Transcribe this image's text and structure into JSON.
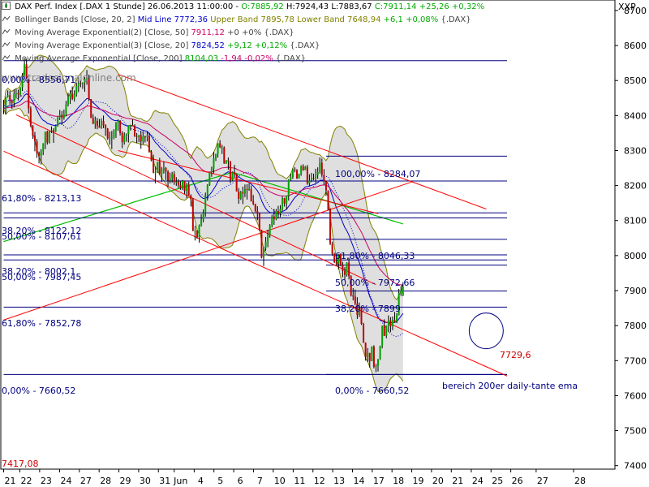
{
  "header": {
    "row1": {
      "symbol": "DAX Perf. Index [.DAX  1 Stunde]",
      "datetime": "26.06.2013 11:00:00",
      "open": "O:7885,92",
      "high": "H:7924,43",
      "low": "L:7883,67",
      "close": "C:7911,14",
      "change": "+25,26",
      "change_pct": "+0,32%"
    },
    "row2": {
      "name": "Bollinger Bands [Close, 20, 2]",
      "mid": "Mid Line 7772,36",
      "upper": "Upper Band 7895,78",
      "lower": "Lower Band 7648,94",
      "chg": "+6,1",
      "pct": "+0,08%",
      "sym": "{.DAX}"
    },
    "row3": {
      "name": "Moving Average Exponential(2) [Close, 50]",
      "value": "7911,12",
      "chg": "+0",
      "pct": "+0%",
      "sym": "{.DAX}"
    },
    "row4": {
      "name": "Moving Average Exponential(3) [Close, 20]",
      "value": "7824,52",
      "chg": "+9,12",
      "pct": "+0,12%",
      "sym": "{.DAX}"
    },
    "row5": {
      "name": "Moving Average Exponential [Close, 200]",
      "value": "8104,03",
      "chg": "-1,94",
      "pct": "-0,02%",
      "sym": "{.DAX}"
    }
  },
  "colors": {
    "up_candle": "#00a000",
    "down_candle": "#c00000",
    "wick": "#000000",
    "bollinger_fill": "#d4d4d4",
    "bollinger_line": "#808000",
    "ema20": "#0000cc",
    "ema50": "#cc0066",
    "ema200": "#00bb00",
    "levels": "#000080",
    "trendlines": "#ff0000"
  },
  "annotations": {
    "watermark": "www.tradesignalonline.com",
    "fib_top_left": "0,00% - 8556,71",
    "fib_100": "100,00% - 8284,07",
    "fib_61_left": "61,80% - 8213,13",
    "fib_38_left": "38,20% - 8122,12",
    "fib_50_left": "50,00% - 8107,61",
    "fib_61_mid": "61,80% - 8046,33",
    "fib_38_left2": "38,20% - 8002,1",
    "fib_50_left2": "50,00% - 7987,45",
    "fib_50_mid": "50,00% - 7972,66",
    "fib_38_mid": "38,20% - 7899",
    "fib_61_left2": "61,80% - 7852,78",
    "fib_0_left": "0,00% - 7660,52",
    "fib_0_mid": "0,00% - 7660,52",
    "trend_value": "7729,6",
    "note": "bereich 200er daily-tante ema",
    "low_value": "7417,08"
  },
  "chart_data": {
    "type": "candlestick",
    "instrument": "DAX Perf. Index [.DAX  1 Stunde]",
    "y_axis_label": "XXP",
    "y_ticks": [
      8700,
      8600,
      8500,
      8400,
      8300,
      8200,
      8100,
      8000,
      7900,
      7800,
      7700,
      7600,
      7500,
      7400
    ],
    "ylim": [
      7390,
      8730
    ],
    "x_tick_labels": [
      "21",
      "22",
      "23",
      "24",
      "27",
      "28",
      "29",
      "30",
      "31",
      "Jun",
      "4",
      "5",
      "6",
      "7",
      "10",
      "11",
      "12",
      "13",
      "14",
      "17",
      "18",
      "19",
      "20",
      "21",
      "24",
      "25",
      "26",
      "27",
      "28"
    ],
    "x_tick_slots": [
      0,
      7.8,
      17.3,
      26.9,
      36.4,
      45.9,
      55.4,
      64.9,
      74.4,
      82.0,
      91.6,
      101.1,
      110.6,
      120.1,
      129.6,
      139.2,
      148.7,
      158.2,
      167.7,
      177.2,
      186.7,
      196.2,
      205.7,
      215.2,
      224.8,
      234.3,
      243.8,
      256.0,
      274.0
    ],
    "ohlc": [
      [
        8420,
        8445,
        8404,
        8420
      ],
      [
        8420,
        8454,
        8404,
        8454
      ],
      [
        8454,
        8472,
        8451,
        8458
      ],
      [
        8458,
        8470,
        8431,
        8441
      ],
      [
        8441,
        8446,
        8419,
        8436
      ],
      [
        8436,
        8474,
        8423,
        8461
      ],
      [
        8461,
        8476,
        8449,
        8464
      ],
      [
        8464,
        8474,
        8443,
        8460
      ],
      [
        8460,
        8481,
        8454,
        8481
      ],
      [
        8481,
        8521,
        8470,
        8514
      ],
      [
        8514,
        8564,
        8510,
        8546
      ],
      [
        8546,
        8562,
        8505,
        8505
      ],
      [
        8505,
        8505,
        8406,
        8420
      ],
      [
        8420,
        8426,
        8367,
        8370
      ],
      [
        8370,
        8373,
        8333,
        8343
      ],
      [
        8343,
        8353,
        8298,
        8326
      ],
      [
        8326,
        8333,
        8279,
        8293
      ],
      [
        8293,
        8297,
        8263,
        8285
      ],
      [
        8285,
        8304,
        8260,
        8298
      ],
      [
        8298,
        8321,
        8287,
        8321
      ],
      [
        8321,
        8354,
        8304,
        8354
      ],
      [
        8354,
        8357,
        8317,
        8323
      ],
      [
        8323,
        8356,
        8320,
        8356
      ],
      [
        8356,
        8369,
        8350,
        8358
      ],
      [
        8358,
        8364,
        8322,
        8354
      ],
      [
        8354,
        8374,
        8353,
        8371
      ],
      [
        8371,
        8397,
        8368,
        8395
      ],
      [
        8395,
        8416,
        8387,
        8402
      ],
      [
        8402,
        8413,
        8373,
        8393
      ],
      [
        8393,
        8417,
        8388,
        8404
      ],
      [
        8404,
        8442,
        8398,
        8432
      ],
      [
        8432,
        8465,
        8426,
        8453
      ],
      [
        8453,
        8473,
        8433,
        8463
      ],
      [
        8463,
        8483,
        8444,
        8448
      ],
      [
        8448,
        8472,
        8440,
        8461
      ],
      [
        8461,
        8494,
        8454,
        8484
      ],
      [
        8484,
        8509,
        8467,
        8492
      ],
      [
        8492,
        8500,
        8481,
        8491
      ],
      [
        8491,
        8495,
        8476,
        8494
      ],
      [
        8494,
        8510,
        8468,
        8505
      ],
      [
        8505,
        8530,
        8488,
        8505
      ],
      [
        8505,
        8517,
        8441,
        8447
      ],
      [
        8447,
        8447,
        8393,
        8393
      ],
      [
        8393,
        8404,
        8375,
        8377
      ],
      [
        8377,
        8397,
        8362,
        8385
      ],
      [
        8385,
        8393,
        8361,
        8370
      ],
      [
        8370,
        8390,
        8365,
        8365
      ],
      [
        8365,
        8392,
        8362,
        8384
      ],
      [
        8384,
        8400,
        8364,
        8372
      ],
      [
        8372,
        8375,
        8342,
        8363
      ],
      [
        8363,
        8364,
        8331,
        8335
      ],
      [
        8335,
        8354,
        8317,
        8338
      ],
      [
        8338,
        8356,
        8304,
        8338
      ],
      [
        8338,
        8361,
        8332,
        8358
      ],
      [
        8358,
        8382,
        8336,
        8378
      ],
      [
        8378,
        8389,
        8356,
        8385
      ],
      [
        8385,
        8387,
        8343,
        8350
      ],
      [
        8350,
        8355,
        8307,
        8324
      ],
      [
        8324,
        8352,
        8317,
        8343
      ],
      [
        8343,
        8349,
        8325,
        8347
      ],
      [
        8347,
        8372,
        8323,
        8372
      ],
      [
        8372,
        8374,
        8357,
        8373
      ],
      [
        8373,
        8389,
        8370,
        8370
      ],
      [
        8370,
        8375,
        8339,
        8341
      ],
      [
        8341,
        8350,
        8321,
        8339
      ],
      [
        8339,
        8345,
        8324,
        8344
      ],
      [
        8344,
        8356,
        8305,
        8326
      ],
      [
        8326,
        8355,
        8318,
        8340
      ],
      [
        8340,
        8343,
        8323,
        8339
      ],
      [
        8339,
        8354,
        8326,
        8342
      ],
      [
        8342,
        8351,
        8294,
        8296
      ],
      [
        8296,
        8301,
        8269,
        8271
      ],
      [
        8271,
        8288,
        8235,
        8237
      ],
      [
        8237,
        8254,
        8206,
        8239
      ],
      [
        8239,
        8268,
        8236,
        8268
      ],
      [
        8268,
        8279,
        8230,
        8233
      ],
      [
        8233,
        8253,
        8210,
        8246
      ],
      [
        8246,
        8268,
        8234,
        8250
      ],
      [
        8250,
        8253,
        8216,
        8240
      ],
      [
        8240,
        8244,
        8196,
        8214
      ],
      [
        8214,
        8237,
        8206,
        8221
      ],
      [
        8221,
        8239,
        8208,
        8233
      ],
      [
        8233,
        8241,
        8202,
        8210
      ],
      [
        8210,
        8224,
        8199,
        8211
      ],
      [
        8211,
        8218,
        8193,
        8201
      ],
      [
        8201,
        8212,
        8188,
        8193
      ],
      [
        8193,
        8216,
        8187,
        8213
      ],
      [
        8213,
        8214,
        8176,
        8185
      ],
      [
        8185,
        8208,
        8164,
        8203
      ],
      [
        8203,
        8211,
        8171,
        8172
      ],
      [
        8172,
        8175,
        8140,
        8161
      ],
      [
        8161,
        8164,
        8070,
        8070
      ],
      [
        8070,
        8085,
        8043,
        8071
      ],
      [
        8071,
        8073,
        8048,
        8053
      ],
      [
        8053,
        8089,
        8037,
        8085
      ],
      [
        8085,
        8118,
        8083,
        8103
      ],
      [
        8103,
        8132,
        8095,
        8122
      ],
      [
        8122,
        8180,
        8111,
        8170
      ],
      [
        8170,
        8204,
        8157,
        8201
      ],
      [
        8201,
        8238,
        8199,
        8238
      ],
      [
        8238,
        8254,
        8225,
        8248
      ],
      [
        8248,
        8296,
        8235,
        8279
      ],
      [
        8279,
        8291,
        8270,
        8290
      ],
      [
        8290,
        8321,
        8280,
        8321
      ],
      [
        8321,
        8330,
        8307,
        8309
      ],
      [
        8309,
        8316,
        8290,
        8309
      ],
      [
        8309,
        8312,
        8262,
        8263
      ],
      [
        8263,
        8273,
        8262,
        8272
      ],
      [
        8272,
        8280,
        8245,
        8269
      ],
      [
        8269,
        8270,
        8207,
        8215
      ],
      [
        8215,
        8240,
        8213,
        8238
      ],
      [
        8238,
        8259,
        8222,
        8232
      ],
      [
        8232,
        8234,
        8183,
        8183
      ],
      [
        8183,
        8193,
        8148,
        8162
      ],
      [
        8162,
        8185,
        8159,
        8181
      ],
      [
        8181,
        8197,
        8147,
        8177
      ],
      [
        8177,
        8203,
        8167,
        8190
      ],
      [
        8190,
        8204,
        8160,
        8187
      ],
      [
        8187,
        8207,
        8185,
        8190
      ],
      [
        8190,
        8200,
        8154,
        8156
      ],
      [
        8156,
        8173,
        8144,
        8148
      ],
      [
        8148,
        8148,
        8124,
        8127
      ],
      [
        8127,
        8141,
        8101,
        8120
      ],
      [
        8120,
        8122,
        8070,
        8072
      ],
      [
        8072,
        8074,
        7992,
        7994
      ],
      [
        7994,
        8025,
        7970,
        8022
      ],
      [
        8022,
        8053,
        8014,
        8040
      ],
      [
        8040,
        8074,
        8024,
        8059
      ],
      [
        8059,
        8090,
        8051,
        8086
      ],
      [
        8086,
        8117,
        8080,
        8112
      ],
      [
        8112,
        8133,
        8088,
        8104
      ],
      [
        8104,
        8133,
        8101,
        8127
      ],
      [
        8127,
        8142,
        8106,
        8121
      ],
      [
        8121,
        8144,
        8110,
        8133
      ],
      [
        8133,
        8169,
        8128,
        8164
      ],
      [
        8164,
        8165,
        8140,
        8149
      ],
      [
        8149,
        8172,
        8131,
        8171
      ],
      [
        8171,
        8218,
        8157,
        8215
      ],
      [
        8215,
        8234,
        8214,
        8224
      ],
      [
        8224,
        8249,
        8219,
        8246
      ],
      [
        8246,
        8252,
        8238,
        8244
      ],
      [
        8244,
        8247,
        8219,
        8220
      ],
      [
        8220,
        8234,
        8220,
        8233
      ],
      [
        8233,
        8258,
        8228,
        8255
      ],
      [
        8255,
        8261,
        8242,
        8244
      ],
      [
        8244,
        8256,
        8244,
        8253
      ],
      [
        8253,
        8259,
        8202,
        8206
      ],
      [
        8206,
        8232,
        8198,
        8214
      ],
      [
        8214,
        8236,
        8210,
        8222
      ],
      [
        8222,
        8234,
        8215,
        8221
      ],
      [
        8221,
        8248,
        8208,
        8230
      ],
      [
        8230,
        8252,
        8219,
        8239
      ],
      [
        8239,
        8280,
        8234,
        8265
      ],
      [
        8265,
        8277,
        8225,
        8230
      ],
      [
        8230,
        8247,
        8202,
        8212
      ],
      [
        8212,
        8213,
        8170,
        8186
      ],
      [
        8186,
        8186,
        8129,
        8131
      ],
      [
        8131,
        8135,
        8030,
        8034
      ],
      [
        8034,
        8040,
        7999,
        8005
      ],
      [
        8005,
        8008,
        7979,
        7981
      ],
      [
        7981,
        8000,
        7972,
        7977
      ],
      [
        7977,
        8004,
        7961,
        8004
      ],
      [
        8004,
        8006,
        7970,
        7973
      ],
      [
        7973,
        7982,
        7938,
        7956
      ],
      [
        7956,
        7967,
        7931,
        7945
      ],
      [
        7945,
        7981,
        7940,
        7980
      ],
      [
        7980,
        7993,
        7932,
        7941
      ],
      [
        7941,
        7944,
        7883,
        7886
      ],
      [
        7886,
        7907,
        7872,
        7883
      ],
      [
        7883,
        7903,
        7858,
        7863
      ],
      [
        7863,
        7881,
        7819,
        7830
      ],
      [
        7830,
        7866,
        7824,
        7851
      ],
      [
        7851,
        7851,
        7802,
        7805
      ],
      [
        7805,
        7808,
        7751,
        7751
      ],
      [
        7751,
        7752,
        7700,
        7710
      ],
      [
        7710,
        7736,
        7696,
        7722
      ],
      [
        7722,
        7722,
        7680,
        7699
      ],
      [
        7699,
        7741,
        7698,
        7740
      ],
      [
        7740,
        7744,
        7678,
        7682
      ],
      [
        7682,
        7691,
        7667,
        7685
      ],
      [
        7685,
        7705,
        7669,
        7704
      ],
      [
        7704,
        7743,
        7702,
        7742
      ],
      [
        7742,
        7800,
        7735,
        7800
      ],
      [
        7800,
        7818,
        7770,
        7771
      ],
      [
        7771,
        7800,
        7764,
        7800
      ],
      [
        7800,
        7829,
        7781,
        7815
      ],
      [
        7815,
        7824,
        7781,
        7798
      ],
      [
        7798,
        7826,
        7787,
        7816
      ],
      [
        7816,
        7839,
        7808,
        7811
      ],
      [
        7811,
        7836,
        7807,
        7830
      ],
      [
        7830,
        7905,
        7829,
        7893
      ],
      [
        7893,
        7913,
        7885,
        7900
      ],
      [
        7886,
        7924,
        7884,
        7911
      ]
    ],
    "levels": [
      {
        "label": "0,00% - 8556,71",
        "value": 8556.71,
        "from": 0,
        "to": 242
      },
      {
        "label": "100,00% - 8284,07",
        "value": 8284.07,
        "from": 155,
        "to": 242
      },
      {
        "label": "61,80% - 8213,13",
        "value": 8213.13,
        "from": 0,
        "to": 242
      },
      {
        "label": "38,20% - 8122,12",
        "value": 8122.12,
        "from": 0,
        "to": 242
      },
      {
        "label": "50,00% - 8107,61",
        "value": 8107.61,
        "from": 0,
        "to": 242
      },
      {
        "label": "61,80% - 8046,33",
        "value": 8046.33,
        "from": 155,
        "to": 242
      },
      {
        "label": "38,20% - 8002,1",
        "value": 8002.1,
        "from": 0,
        "to": 242
      },
      {
        "label": "50,00% - 7987,45",
        "value": 7987.45,
        "from": 0,
        "to": 242
      },
      {
        "label": "50,00% - 7972,66",
        "value": 7972.66,
        "from": 155,
        "to": 242
      },
      {
        "label": "38,20% - 7899",
        "value": 7899,
        "from": 155,
        "to": 242
      },
      {
        "label": "61,80% - 7852,78",
        "value": 7852.78,
        "from": 0,
        "to": 242
      },
      {
        "label": "0,00% - 7660,52",
        "value": 7660.52,
        "from": 0,
        "to": 242
      },
      {
        "label": "0,00% - 7660,52",
        "value": 7660.52,
        "from": 155,
        "to": 242
      }
    ],
    "trendlines": [
      {
        "from": [
          6,
          8402
        ],
        "to": [
          179,
          7917
        ]
      },
      {
        "from": [
          55,
          8518
        ],
        "to": [
          232,
          8133
        ]
      },
      {
        "from": [
          0,
          8298
        ],
        "to": [
          242,
          7656
        ]
      },
      {
        "from": [
          0,
          7816
        ],
        "to": [
          196,
          8210
        ]
      },
      {
        "from": [
          55,
          8300
        ],
        "to": [
          180,
          8120
        ]
      }
    ]
  }
}
